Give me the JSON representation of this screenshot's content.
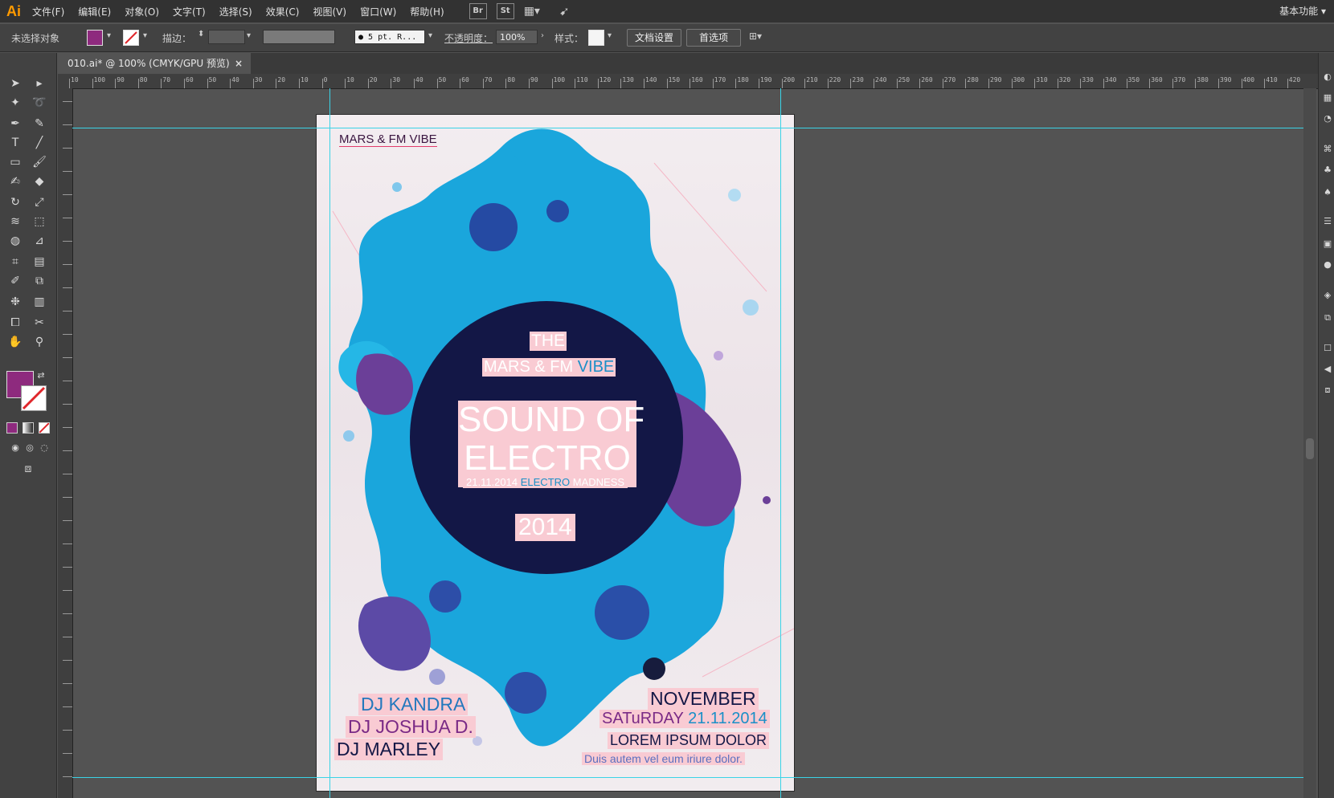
{
  "app": {
    "logo": "Ai",
    "workspace": "基本功能"
  },
  "menu": [
    "文件(F)",
    "编辑(E)",
    "对象(O)",
    "文字(T)",
    "选择(S)",
    "效果(C)",
    "视图(V)",
    "窗口(W)",
    "帮助(H)"
  ],
  "menu_icons": {
    "br": "Br",
    "st": "St"
  },
  "control": {
    "selection": "未选择对象",
    "fill_color": "#8e2a7e",
    "stroke_label": "描边：",
    "brush": "● 5 pt. R...",
    "opacity_label": "不透明度：",
    "opacity_value": "100%",
    "style_label": "样式：",
    "doc_setup": "文档设置",
    "prefs": "首选项"
  },
  "document": {
    "tab_title": "010.ai* @ 100% (CMYK/GPU 预览)",
    "close": "×"
  },
  "ruler": {
    "h_labels": [
      "10",
      "100",
      "90",
      "80",
      "70",
      "60",
      "50",
      "40",
      "30",
      "20",
      "10",
      "0",
      "10",
      "20",
      "30",
      "40",
      "50",
      "60",
      "70",
      "80",
      "90",
      "100",
      "110",
      "120",
      "130",
      "140",
      "150",
      "160",
      "170",
      "180",
      "190",
      "200",
      "210",
      "220",
      "230",
      "240",
      "250",
      "260",
      "270",
      "280",
      "290",
      "300",
      "310",
      "320",
      "330",
      "340",
      "350",
      "360",
      "370",
      "380",
      "390",
      "400",
      "410",
      "420"
    ]
  },
  "poster": {
    "top_left": "MARS & FM VIBE",
    "the": "THE",
    "mars_fm": "MARS & FM",
    "vibe": "VIBE",
    "sound_of": "SOUND OF",
    "electro": "ELECTRO",
    "date_small": "21.11.2014",
    "electro_small": "ELECTRO",
    "madness": "MADNESS",
    "year": "2014",
    "dj1": "DJ KANDRA",
    "dj2": "DJ JOSHUA D.",
    "dj3": "DJ MARLEY",
    "month": "NOVEMBER",
    "saturday": "SATuRDAY",
    "date": "21.11.2014",
    "lorem": "LOREM IPSUM DOLOR",
    "duis": "Duis autem vel eum iriure dolor."
  },
  "colors": {
    "navy": "#131746",
    "cyan": "#1aa3d9",
    "purple": "#6b3f98",
    "pink": "#f9cbd3",
    "magenta": "#8e2a7e"
  }
}
